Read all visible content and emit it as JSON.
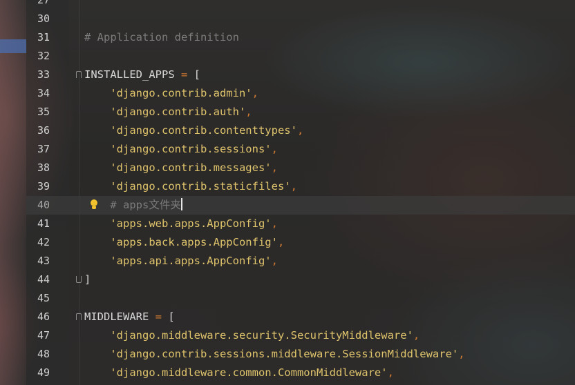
{
  "editor": {
    "current_line": "40",
    "lines": [
      {
        "n": "27",
        "segments": []
      },
      {
        "n": "30",
        "segments": []
      },
      {
        "n": "31",
        "segments": [
          {
            "t": "# Application definition",
            "c": "c-comment"
          }
        ]
      },
      {
        "n": "32",
        "segments": []
      },
      {
        "n": "33",
        "segments": [
          {
            "t": "INSTALLED_APPS",
            "c": "c-ident"
          },
          {
            "t": " = ",
            "c": "c-op"
          },
          {
            "t": "[",
            "c": "c-pun"
          }
        ]
      },
      {
        "n": "34",
        "segments": [
          {
            "t": "    'django.contrib.admin'",
            "c": "c-str"
          },
          {
            "t": ",",
            "c": "c-comma"
          }
        ]
      },
      {
        "n": "35",
        "segments": [
          {
            "t": "    'django.contrib.auth'",
            "c": "c-str"
          },
          {
            "t": ",",
            "c": "c-comma"
          }
        ]
      },
      {
        "n": "36",
        "segments": [
          {
            "t": "    'django.contrib.contenttypes'",
            "c": "c-str"
          },
          {
            "t": ",",
            "c": "c-comma"
          }
        ]
      },
      {
        "n": "37",
        "segments": [
          {
            "t": "    'django.contrib.sessions'",
            "c": "c-str"
          },
          {
            "t": ",",
            "c": "c-comma"
          }
        ]
      },
      {
        "n": "38",
        "segments": [
          {
            "t": "    'django.contrib.messages'",
            "c": "c-str"
          },
          {
            "t": ",",
            "c": "c-comma"
          }
        ]
      },
      {
        "n": "39",
        "segments": [
          {
            "t": "    'django.contrib.staticfiles'",
            "c": "c-str"
          },
          {
            "t": ",",
            "c": "c-comma"
          }
        ]
      },
      {
        "n": "40",
        "segments": [
          {
            "t": "    # apps文件夹",
            "c": "c-comment"
          }
        ]
      },
      {
        "n": "41",
        "segments": [
          {
            "t": "    'apps.web.apps.AppConfig'",
            "c": "c-str"
          },
          {
            "t": ",",
            "c": "c-comma"
          }
        ]
      },
      {
        "n": "42",
        "segments": [
          {
            "t": "    'apps.back.apps.AppConfig'",
            "c": "c-str"
          },
          {
            "t": ",",
            "c": "c-comma"
          }
        ]
      },
      {
        "n": "43",
        "segments": [
          {
            "t": "    'apps.api.apps.AppConfig'",
            "c": "c-str"
          },
          {
            "t": ",",
            "c": "c-comma"
          }
        ]
      },
      {
        "n": "44",
        "segments": [
          {
            "t": "]",
            "c": "c-pun"
          }
        ]
      },
      {
        "n": "45",
        "segments": []
      },
      {
        "n": "46",
        "segments": [
          {
            "t": "MIDDLEWARE",
            "c": "c-ident"
          },
          {
            "t": " = ",
            "c": "c-op"
          },
          {
            "t": "[",
            "c": "c-pun"
          }
        ]
      },
      {
        "n": "47",
        "segments": [
          {
            "t": "    'django.middleware.security.SecurityMiddleware'",
            "c": "c-str"
          },
          {
            "t": ",",
            "c": "c-comma"
          }
        ]
      },
      {
        "n": "48",
        "segments": [
          {
            "t": "    'django.contrib.sessions.middleware.SessionMiddleware'",
            "c": "c-str"
          },
          {
            "t": ",",
            "c": "c-comma"
          }
        ]
      },
      {
        "n": "49",
        "segments": [
          {
            "t": "    'django.middleware.common.CommonMiddleware'",
            "c": "c-str"
          },
          {
            "t": ",",
            "c": "c-comma"
          }
        ]
      }
    ],
    "fold_start_lines": [
      "33",
      "46"
    ],
    "fold_end_lines": [
      "44"
    ],
    "intention_bulb_line": "40",
    "colors": {
      "comment": "#7c7c7c",
      "identifier": "#d8d8d8",
      "operator": "#cc7832",
      "string": "#e0c46c",
      "bulb": "#f2c12e",
      "caret": "#e8e8e8"
    },
    "icons": {
      "intention": "lightbulb-icon",
      "fold": "fold-marker-icon"
    }
  }
}
